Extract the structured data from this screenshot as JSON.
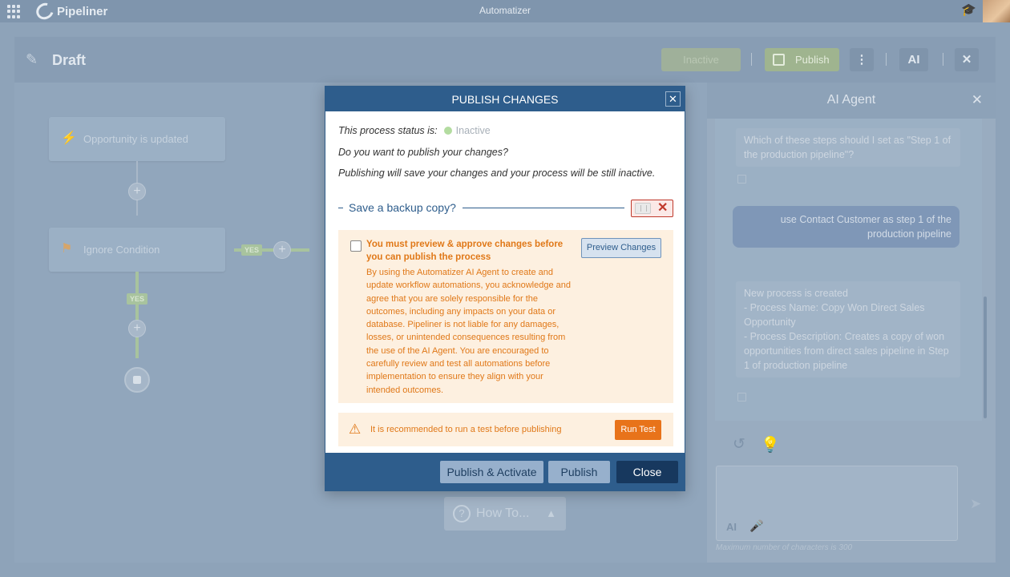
{
  "topbar": {
    "logo_text": "Pipeliner",
    "app_title": "Automatizer"
  },
  "header": {
    "title": "Draft",
    "inactive_label": "Inactive",
    "publish_label": "Publish",
    "ai_label": "AI"
  },
  "canvas": {
    "trigger_node": "Opportunity is updated",
    "condition_node": "Ignore Condition",
    "yes_label": "YES",
    "howto_label": "How To..."
  },
  "ai_agent": {
    "title": "AI Agent",
    "messages": [
      {
        "role": "bot",
        "text": "Which of these steps should I set as \"Step 1 of the production pipeline\"?"
      },
      {
        "role": "user",
        "text": "use Contact Customer as step 1 of the production pipeline"
      },
      {
        "role": "bot",
        "lines": [
          "New process is created",
          "- Process Name: Copy Won Direct Sales Opportunity",
          "- Process Description: Creates a copy of won opportunities from direct sales pipeline in Step 1 of production pipeline"
        ]
      }
    ],
    "input_ai_label": "AI",
    "max_chars_note": "Maximum number of characters is 300"
  },
  "modal": {
    "title": "PUBLISH CHANGES",
    "status_prefix": "This process status is:",
    "status_value": "Inactive",
    "question": "Do you want to publish your changes?",
    "note": "Publishing will save your changes and your process will be still inactive.",
    "backup_label": "Save a backup copy?",
    "warning_title": "You must preview & approve changes before you can publish the process",
    "warning_text": "By using the Automatizer AI Agent to create and update workflow automations, you acknowledge and agree that you are solely responsible for the outcomes, including any impacts on your data or database. Pipeliner is not liable for any damages, losses, or unintended consequences resulting from the use of the AI Agent. You are encouraged to carefully review and test all automations before implementation to ensure they align with your intended outcomes.",
    "preview_button": "Preview Changes",
    "test_text": "It is recommended to run a test before publishing",
    "run_test_button": "Run Test",
    "publish_activate_button": "Publish & Activate",
    "publish_button": "Publish",
    "close_button": "Close"
  },
  "colors": {
    "modal_header": "#2e5d8c",
    "warning_text": "#e07818",
    "run_test": "#e8731a",
    "toggle_off": "#c0392b"
  }
}
